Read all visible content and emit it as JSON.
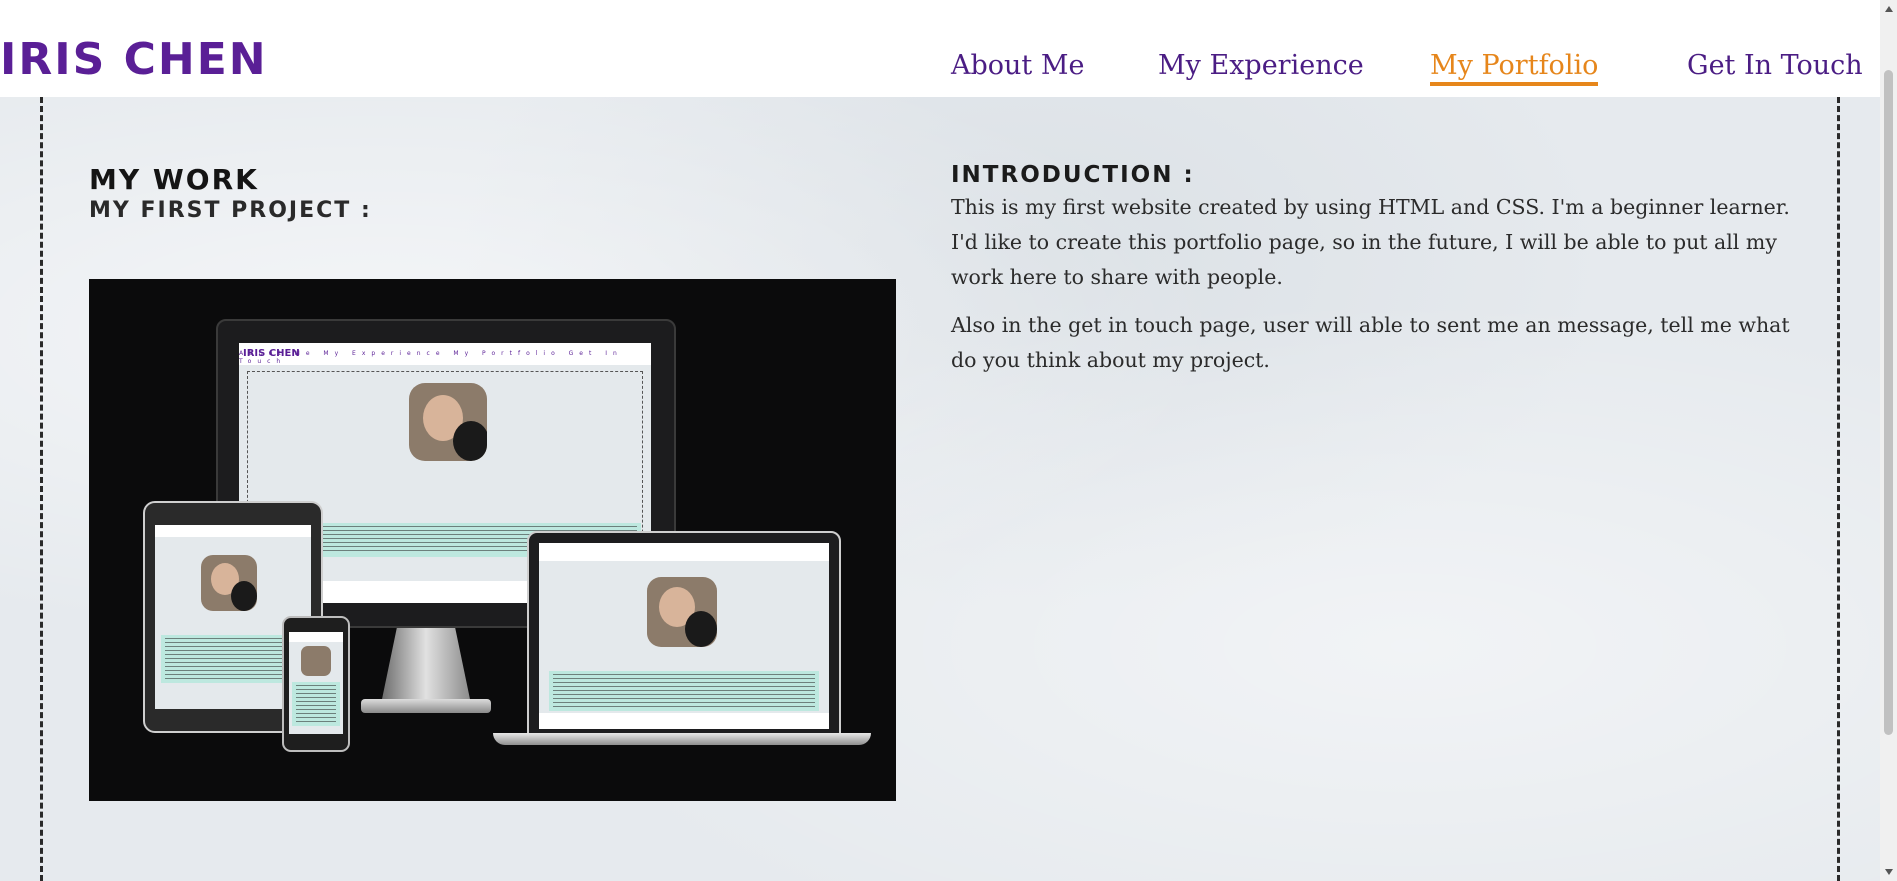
{
  "header": {
    "brand": "IRIS CHEN",
    "nav": [
      {
        "label": "About Me",
        "active": false
      },
      {
        "label": "My Experience",
        "active": false
      },
      {
        "label": "My Portfolio",
        "active": true
      },
      {
        "label": "Get In Touch",
        "active": false
      }
    ]
  },
  "colors": {
    "brand": "#5a1f96",
    "nav": "#4b1d84",
    "nav_active": "#e6861b",
    "background": "#e9edf0"
  },
  "work": {
    "title": "MY WORK",
    "project_title": "MY FIRST PROJECT :"
  },
  "mockup": {
    "device_brand": "IRIS CHEN",
    "device_nav": "About Me   My Experience   My Portfolio   Get In Touch"
  },
  "intro": {
    "heading": "INTRODUCTION :",
    "paragraphs": [
      "This is my first website created by using HTML and CSS. I'm a beginner learner. I'd like to create this portfolio page, so in the future, I will be able to put all my work here to share with people.",
      "Also in the get in touch page, user will able to sent me an message, tell me what do you think about my project."
    ]
  }
}
